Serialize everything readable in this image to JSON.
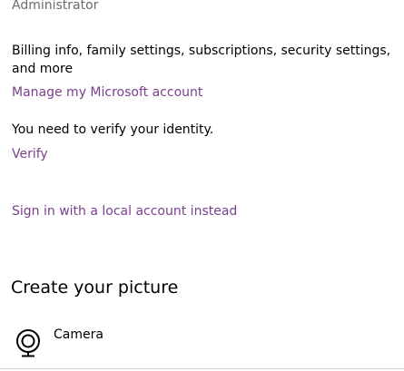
{
  "account": {
    "role": "Administrator",
    "description": "Billing info, family settings, subscriptions, security settings, and more",
    "manage_link": "Manage my Microsoft account",
    "verify_message": "You need to verify your identity.",
    "verify_link": "Verify",
    "local_account_link": "Sign in with a local account instead"
  },
  "picture": {
    "heading": "Create your picture",
    "options": [
      {
        "label": "Camera",
        "icon": "camera-icon"
      }
    ]
  },
  "colors": {
    "link": "#7a3f8f",
    "secondary_text": "#6b6b6b"
  }
}
